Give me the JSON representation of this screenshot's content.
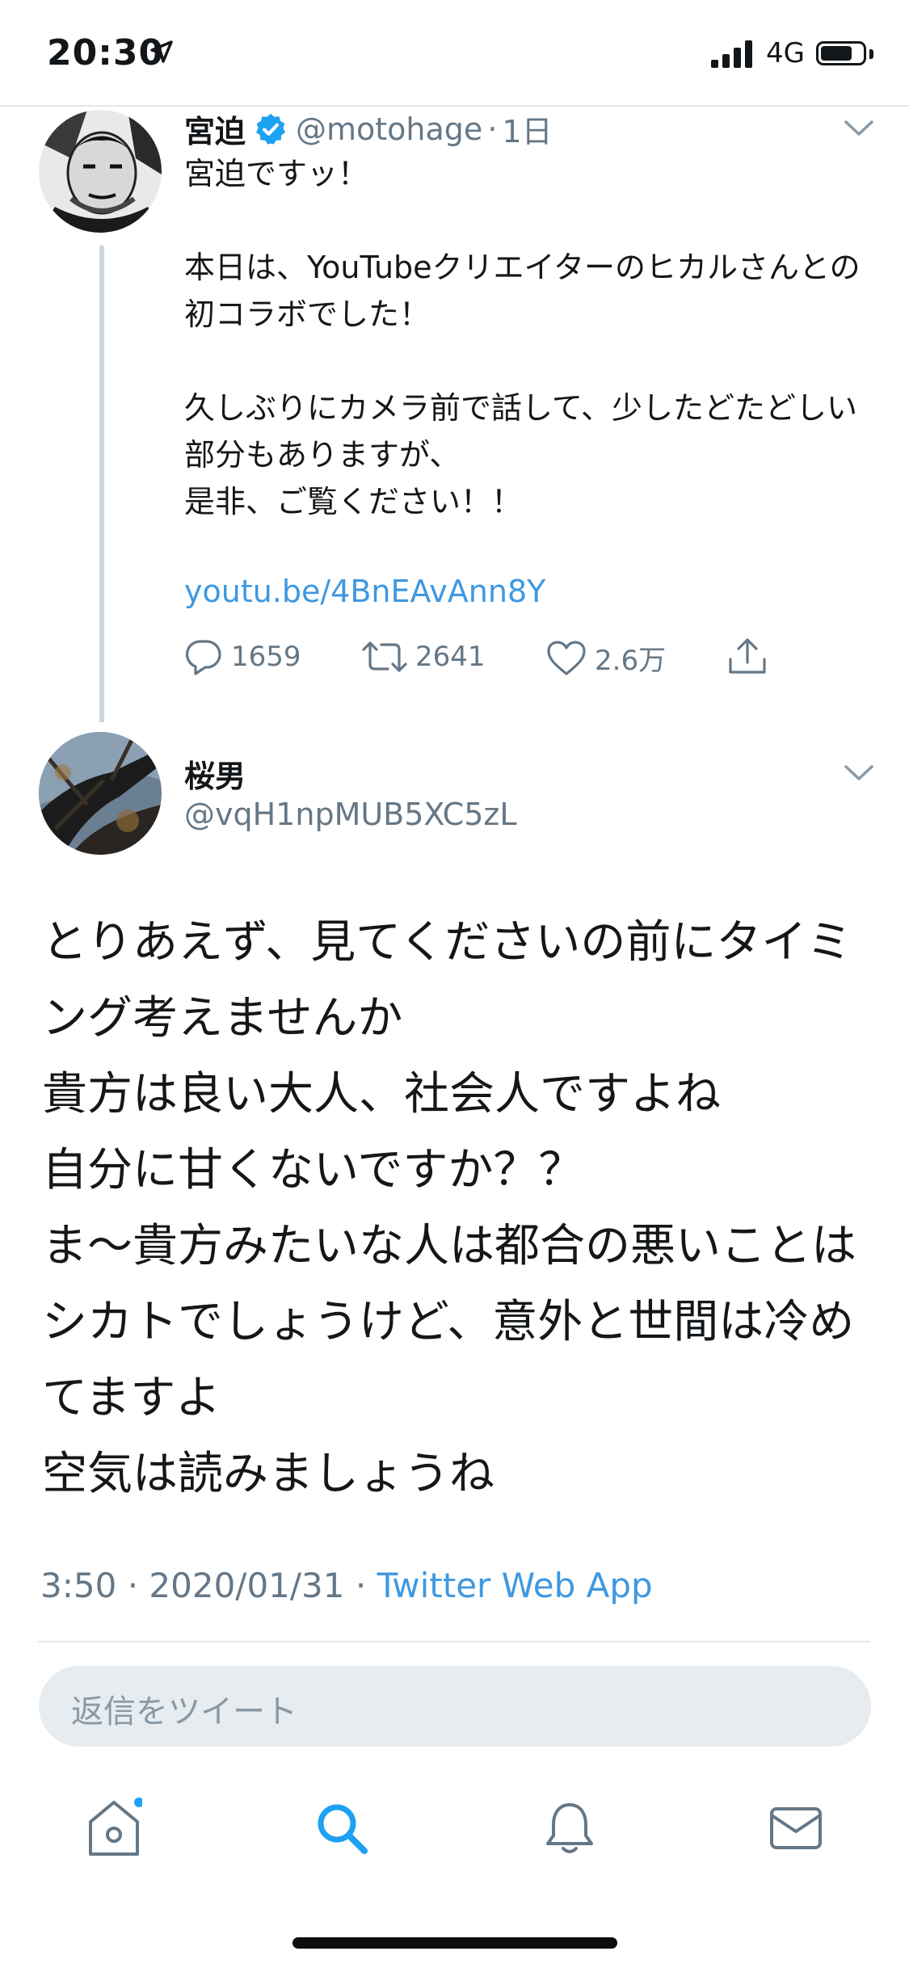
{
  "status_bar": {
    "time": "20:30",
    "network": "4G",
    "battery_level": 0.75
  },
  "parent_tweet": {
    "author_name": "宮迫",
    "handle": "@motohage",
    "separator": "·",
    "time_ago": "1日",
    "body": "宮迫ですッ！\n\n本日は、YouTubeクリエイターのヒカルさんとの初コラボでした！\n\n久しぶりにカメラ前で話して、少したどたどしい部分もありますが、\n是非、ご覧ください！！",
    "link": "youtu.be/4BnEAvAnn8Y",
    "replies": "1659",
    "retweets": "2641",
    "likes": "2.6万"
  },
  "reply_tweet": {
    "author_name": "桜男",
    "handle": "@vqH1npMUB5XC5zL",
    "body": "とりあえず、見てくださいの前にタイミング考えませんか\n貴方は良い大人、社会人ですよね\n自分に甘くないですか？？\nま〜貴方みたいな人は都合の悪いことはシカトでしょうけど、意外と世間は冷めてますよ\n空気は読みましょうね",
    "time": "3:50",
    "dot1": "·",
    "date": "2020/01/31",
    "dot2": "·",
    "source": "Twitter Web App"
  },
  "reply_input": {
    "placeholder": "返信をツイート"
  },
  "colors": {
    "accent": "#1da1f2",
    "link": "#3f98e0",
    "muted": "#657786",
    "verified": "#1da1f2"
  },
  "tab_bar": {
    "icons": [
      "home-icon",
      "search-icon",
      "bell-icon",
      "mail-icon"
    ],
    "active": "search-icon"
  }
}
